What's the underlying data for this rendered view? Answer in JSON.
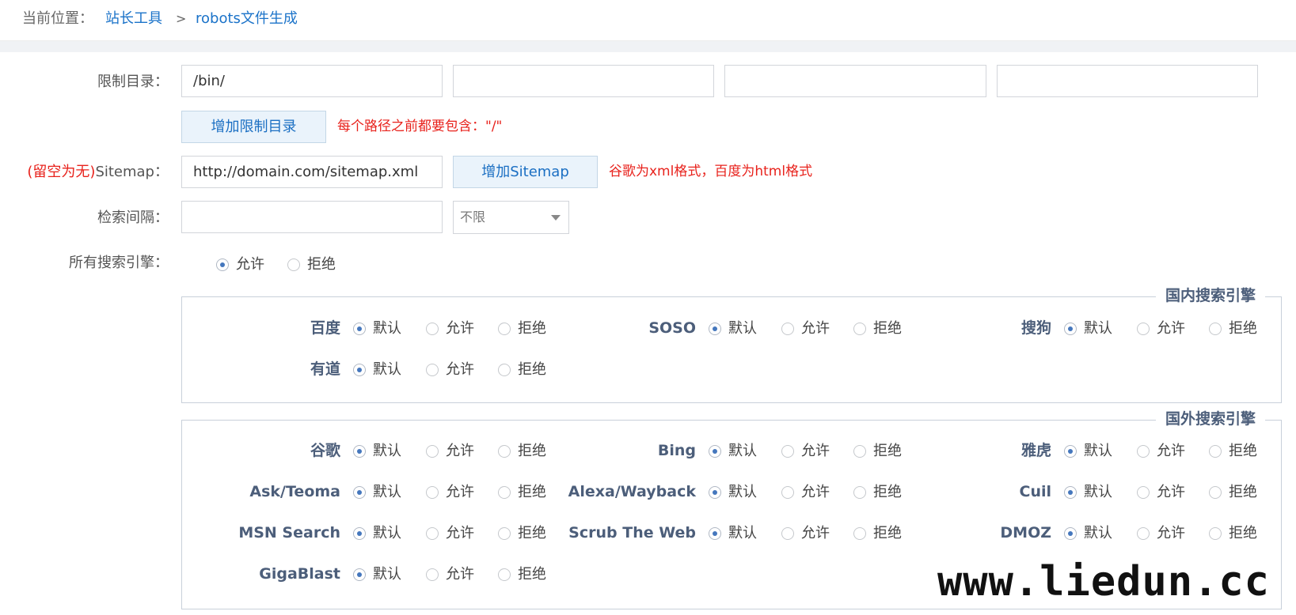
{
  "breadcrumb": {
    "prefix": "当前位置：",
    "link1": "站长工具",
    "separator": ">",
    "link2": "robots文件生成"
  },
  "form": {
    "restrict_label": "限制目录：",
    "restrict_inputs": [
      "/bin/",
      "",
      "",
      ""
    ],
    "add_restrict_button": "增加限制目录",
    "restrict_hint": "每个路径之前都要包含：\"/\"",
    "sitemap_label_red": "(留空为无)",
    "sitemap_label": "Sitemap：",
    "sitemap_value": "http://domain.com/sitemap.xml",
    "add_sitemap_button": "增加Sitemap",
    "sitemap_hint": "谷歌为xml格式，百度为html格式",
    "interval_label": "检索间隔：",
    "interval_value": "",
    "interval_select": "不限",
    "all_engines_label": "所有搜索引擎：",
    "all_engines_allow": "允许",
    "all_engines_deny": "拒绝",
    "all_engines_selected": "allow"
  },
  "options": {
    "default": "默认",
    "allow": "允许",
    "deny": "拒绝"
  },
  "domestic": {
    "legend": "国内搜索引擎",
    "engines": [
      "百度",
      "SOSO",
      "搜狗",
      "有道"
    ]
  },
  "foreign": {
    "legend": "国外搜索引擎",
    "engines": [
      "谷歌",
      "Bing",
      "雅虎",
      "Ask/Teoma",
      "Alexa/Wayback",
      "Cuil",
      "MSN Search",
      "Scrub The Web",
      "DMOZ",
      "GigaBlast"
    ]
  },
  "watermark": "www.liedun.cc",
  "colors": {
    "link": "#1b73c9",
    "hint": "#e8221c",
    "engine_label": "#4c5e7a",
    "radio_dot": "#4577bd"
  }
}
